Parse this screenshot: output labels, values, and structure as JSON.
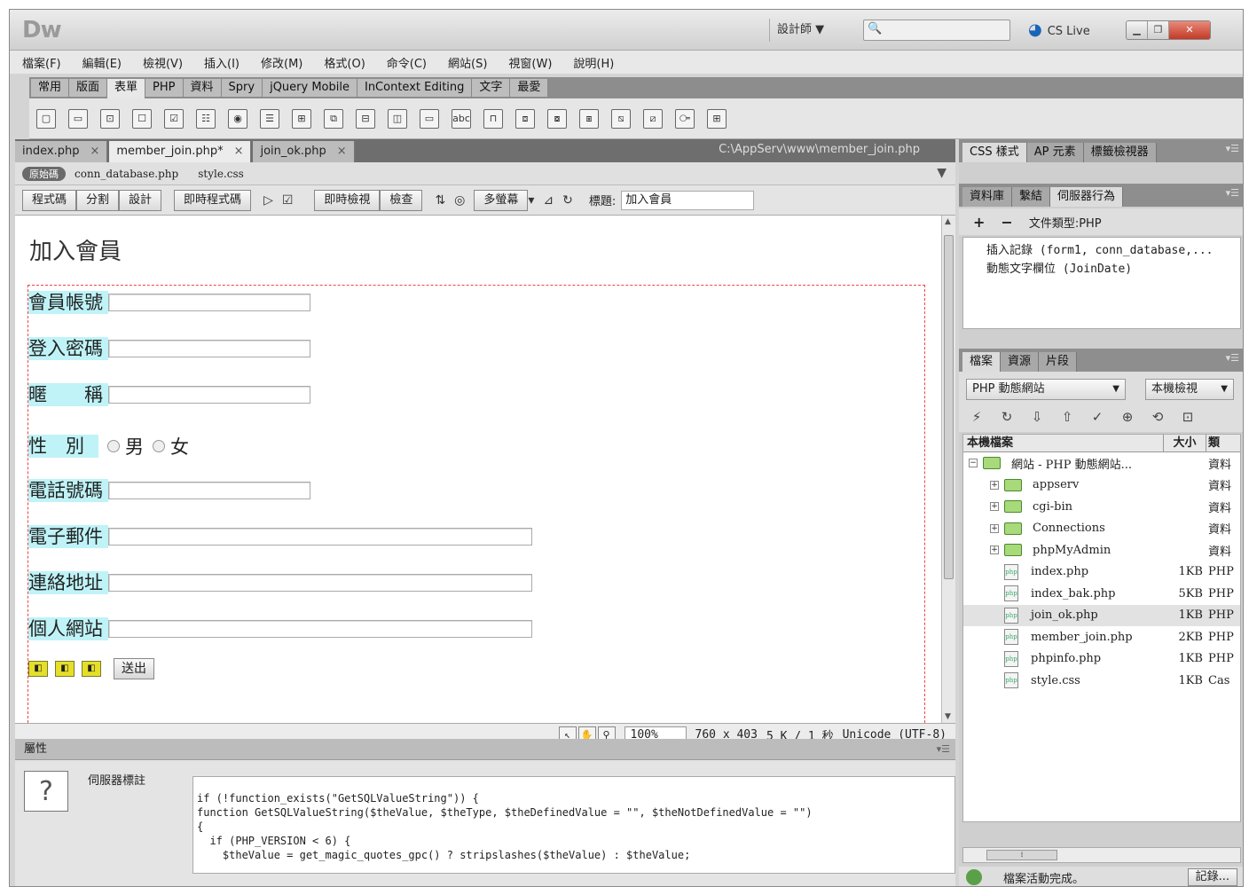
{
  "app": {
    "logo": "Dw",
    "workspace": "設計師 ▼",
    "search_icon": "🔍",
    "cslive": "CS Live"
  },
  "menu": [
    "檔案(F)",
    "編輯(E)",
    "檢視(V)",
    "插入(I)",
    "修改(M)",
    "格式(O)",
    "命令(C)",
    "網站(S)",
    "視窗(W)",
    "說明(H)"
  ],
  "insert_tabs": [
    "常用",
    "版面",
    "表單",
    "PHP",
    "資料",
    "Spry",
    "jQuery Mobile",
    "InContext Editing",
    "文字",
    "最愛"
  ],
  "insert_tabs_active": "表單",
  "doc_tabs": [
    {
      "label": "index.php",
      "close": "×"
    },
    {
      "label": "member_join.php*",
      "close": "×"
    },
    {
      "label": "join_ok.php",
      "close": "×"
    }
  ],
  "doc_path": "C:\\AppServ\\www\\member_join.php",
  "related": {
    "source": "原始碼",
    "files": [
      "conn_database.php",
      "style.css"
    ]
  },
  "doc_toolbar": {
    "code": "程式碼",
    "split": "分割",
    "design": "設計",
    "live_code": "即時程式碼",
    "live_view": "即時檢視",
    "inspect": "檢查",
    "multiscreen": "多螢幕",
    "title_label": "標題:",
    "title_value": "加入會員"
  },
  "page": {
    "heading": "加入會員",
    "fields": [
      {
        "label": "會員帳號"
      },
      {
        "label": "登入密碼"
      },
      {
        "label": "暱　　稱"
      },
      {
        "label": "電話號碼"
      },
      {
        "label": "電子郵件"
      },
      {
        "label": "連絡地址"
      },
      {
        "label": "個人網站"
      }
    ],
    "gender_label": "性　別",
    "gender_options": [
      "男",
      "女"
    ],
    "submit": "送出"
  },
  "status": {
    "zoom": "100%",
    "size": "760 x 403",
    "weight": "5 K / 1 秒",
    "encoding": "Unicode (UTF-8)"
  },
  "properties": {
    "title": "屬性",
    "server_tag": "伺服器標註",
    "code_lines": [
      "if (!function_exists(\"GetSQLValueString\")) {",
      "function GetSQLValueString($theValue, $theType, $theDefinedValue = \"\", $theNotDefinedValue = \"\")",
      "{",
      "  if (PHP_VERSION < 6) {",
      "    $theValue = get_magic_quotes_gpc() ? stripslashes($theValue) : $theValue;"
    ]
  },
  "panels": {
    "top_tabs": [
      "CSS 樣式",
      "AP 元素",
      "標籤檢視器"
    ],
    "mid_tabs": [
      "資料庫",
      "繫結",
      "伺服器行為"
    ],
    "doc_type": "文件類型:PHP",
    "behaviors": [
      "插入記錄 (form1, conn_database,...",
      "動態文字欄位 (JoinDate)"
    ],
    "file_tabs": [
      "檔案",
      "資源",
      "片段"
    ],
    "site": "PHP 動態網站",
    "view": "本機檢視",
    "col_name": "本機檔案",
    "col_size": "大小",
    "col_type": "類",
    "files": [
      {
        "name": "網站 - PHP 動態網站...",
        "size": "",
        "type": "資料",
        "kind": "root"
      },
      {
        "name": "appserv",
        "size": "",
        "type": "資料",
        "kind": "folder"
      },
      {
        "name": "cgi-bin",
        "size": "",
        "type": "資料",
        "kind": "folder"
      },
      {
        "name": "Connections",
        "size": "",
        "type": "資料",
        "kind": "folder"
      },
      {
        "name": "phpMyAdmin",
        "size": "",
        "type": "資料",
        "kind": "folder"
      },
      {
        "name": "index.php",
        "size": "1KB",
        "type": "PHP",
        "kind": "file"
      },
      {
        "name": "index_bak.php",
        "size": "5KB",
        "type": "PHP",
        "kind": "file"
      },
      {
        "name": "join_ok.php",
        "size": "1KB",
        "type": "PHP",
        "kind": "file",
        "selected": true
      },
      {
        "name": "member_join.php",
        "size": "2KB",
        "type": "PHP",
        "kind": "file"
      },
      {
        "name": "phpinfo.php",
        "size": "1KB",
        "type": "PHP",
        "kind": "file"
      },
      {
        "name": "style.css",
        "size": "1KB",
        "type": "Cas",
        "kind": "file"
      }
    ],
    "status_text": "檔案活動完成。",
    "log_button": "記錄..."
  }
}
